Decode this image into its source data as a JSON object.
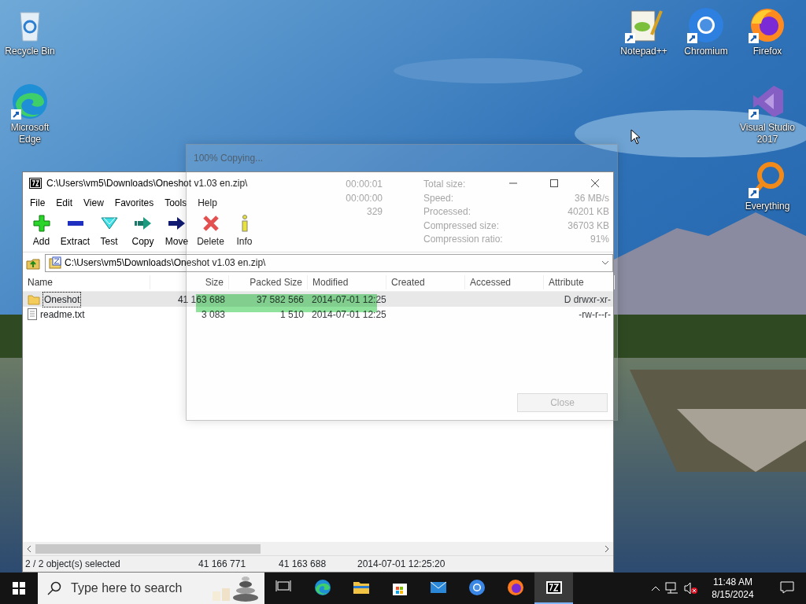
{
  "desktop_icons": [
    {
      "label": "Recycle Bin",
      "kind": "recycle-bin",
      "shortcut": false
    },
    {
      "label": "Microsoft Edge",
      "kind": "edge",
      "shortcut": true
    },
    {
      "label": "Notepad++",
      "kind": "notepad",
      "shortcut": true
    },
    {
      "label": "Chromium",
      "kind": "chromium",
      "shortcut": true
    },
    {
      "label": "Firefox",
      "kind": "firefox",
      "shortcut": true
    },
    {
      "label": "Visual Studio 2017",
      "kind": "visual-studio",
      "shortcut": true
    },
    {
      "label": "Everything",
      "kind": "everything",
      "shortcut": true
    }
  ],
  "archive_window": {
    "title": "C:\\Users\\vm5\\Downloads\\Oneshot v1.03 en.zip\\",
    "menu": [
      "File",
      "Edit",
      "View",
      "Favorites",
      "Tools",
      "Help"
    ],
    "toolbar": [
      {
        "label": "Add",
        "kind": "add"
      },
      {
        "label": "Extract",
        "kind": "extract"
      },
      {
        "label": "Test",
        "kind": "test"
      },
      {
        "label": "Copy",
        "kind": "copy"
      },
      {
        "label": "Move",
        "kind": "move"
      },
      {
        "label": "Delete",
        "kind": "delete"
      },
      {
        "label": "Info",
        "kind": "info"
      }
    ],
    "address": "C:\\Users\\vm5\\Downloads\\Oneshot v1.03 en.zip\\",
    "columns": [
      "Name",
      "Size",
      "Packed Size",
      "Modified",
      "Created",
      "Accessed",
      "Attribute"
    ],
    "rows": [
      {
        "kind": "folder",
        "selected": true,
        "name": "Oneshot",
        "size": "41 163 688",
        "packed": "37 582 566",
        "modified": "2014-07-01 12:25",
        "attributes": "D drwxr-xr-"
      },
      {
        "kind": "file",
        "selected": false,
        "name": "readme.txt",
        "size": "3 083",
        "packed": "1 510",
        "modified": "2014-07-01 12:25",
        "attributes": "-rw-r--r-"
      }
    ],
    "status_bar": [
      "2 / 2 object(s) selected",
      "41 166 771",
      "41 163 688",
      "2014-07-01 12:25:20"
    ]
  },
  "progress_dialog": {
    "title": "100% Copying...",
    "left_stats": [
      {
        "value": "00:00:01"
      },
      {
        "value": "00:00:00"
      },
      {
        "value": "329"
      }
    ],
    "right_stats": [
      {
        "label": "Total size:"
      },
      {
        "label": "Speed:",
        "value": "36 MB/s"
      },
      {
        "label": "Processed:",
        "value": "40201 KB"
      },
      {
        "label": "Compressed size:",
        "value": "36703 KB"
      },
      {
        "label": "Compression ratio:",
        "value": "91%"
      }
    ],
    "close_button": "Close"
  },
  "taskbar": {
    "search": {
      "placeholder": "Type here to search"
    },
    "apps": [
      {
        "kind": "task-view",
        "active": false
      },
      {
        "kind": "edge",
        "active": false
      },
      {
        "kind": "explorer",
        "active": false
      },
      {
        "kind": "store",
        "active": false
      },
      {
        "kind": "mail",
        "active": false
      },
      {
        "kind": "chromium",
        "active": false
      },
      {
        "kind": "firefox",
        "active": false
      },
      {
        "kind": "archiver",
        "active": true
      }
    ],
    "time": "11:48 AM",
    "date": "8/15/2024"
  }
}
